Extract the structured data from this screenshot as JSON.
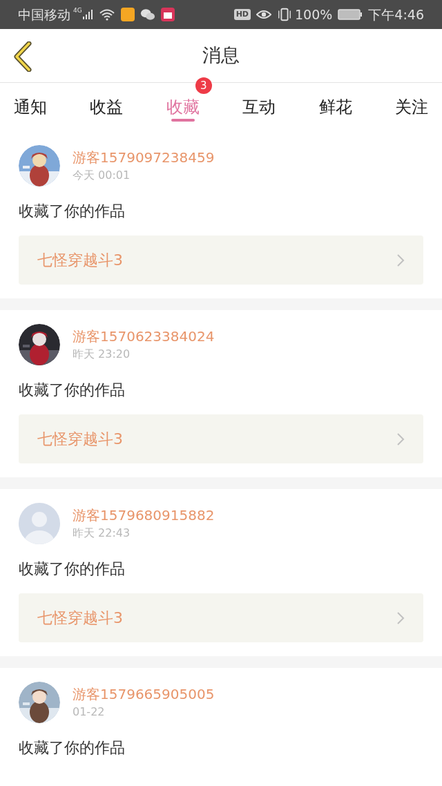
{
  "status_bar": {
    "carrier": "中国移动",
    "network": "4G",
    "hd": "HD",
    "battery": "100%",
    "time": "下午4:46"
  },
  "header": {
    "title": "消息"
  },
  "tabs": [
    {
      "label": "通知",
      "selected": false
    },
    {
      "label": "收益",
      "selected": false
    },
    {
      "label": "收藏",
      "selected": true,
      "badge": "3"
    },
    {
      "label": "互动",
      "selected": false
    },
    {
      "label": "鲜花",
      "selected": false
    },
    {
      "label": "关注",
      "selected": false
    }
  ],
  "messages": [
    {
      "user": "游客1579097238459",
      "time": "今天 00:01",
      "text": "收藏了你的作品",
      "work": "七怪穿越斗3"
    },
    {
      "user": "游客1570623384024",
      "time": "昨天 23:20",
      "text": "收藏了你的作品",
      "work": "七怪穿越斗3"
    },
    {
      "avatar": {
        "kind": "default"
      },
      "user": "游客1579680915882",
      "time": "昨天 22:43",
      "text": "收藏了你的作品",
      "work": "七怪穿越斗3"
    },
    {
      "user": "游客1579665905005",
      "time": "01-22",
      "text": "收藏了你的作品"
    }
  ]
}
